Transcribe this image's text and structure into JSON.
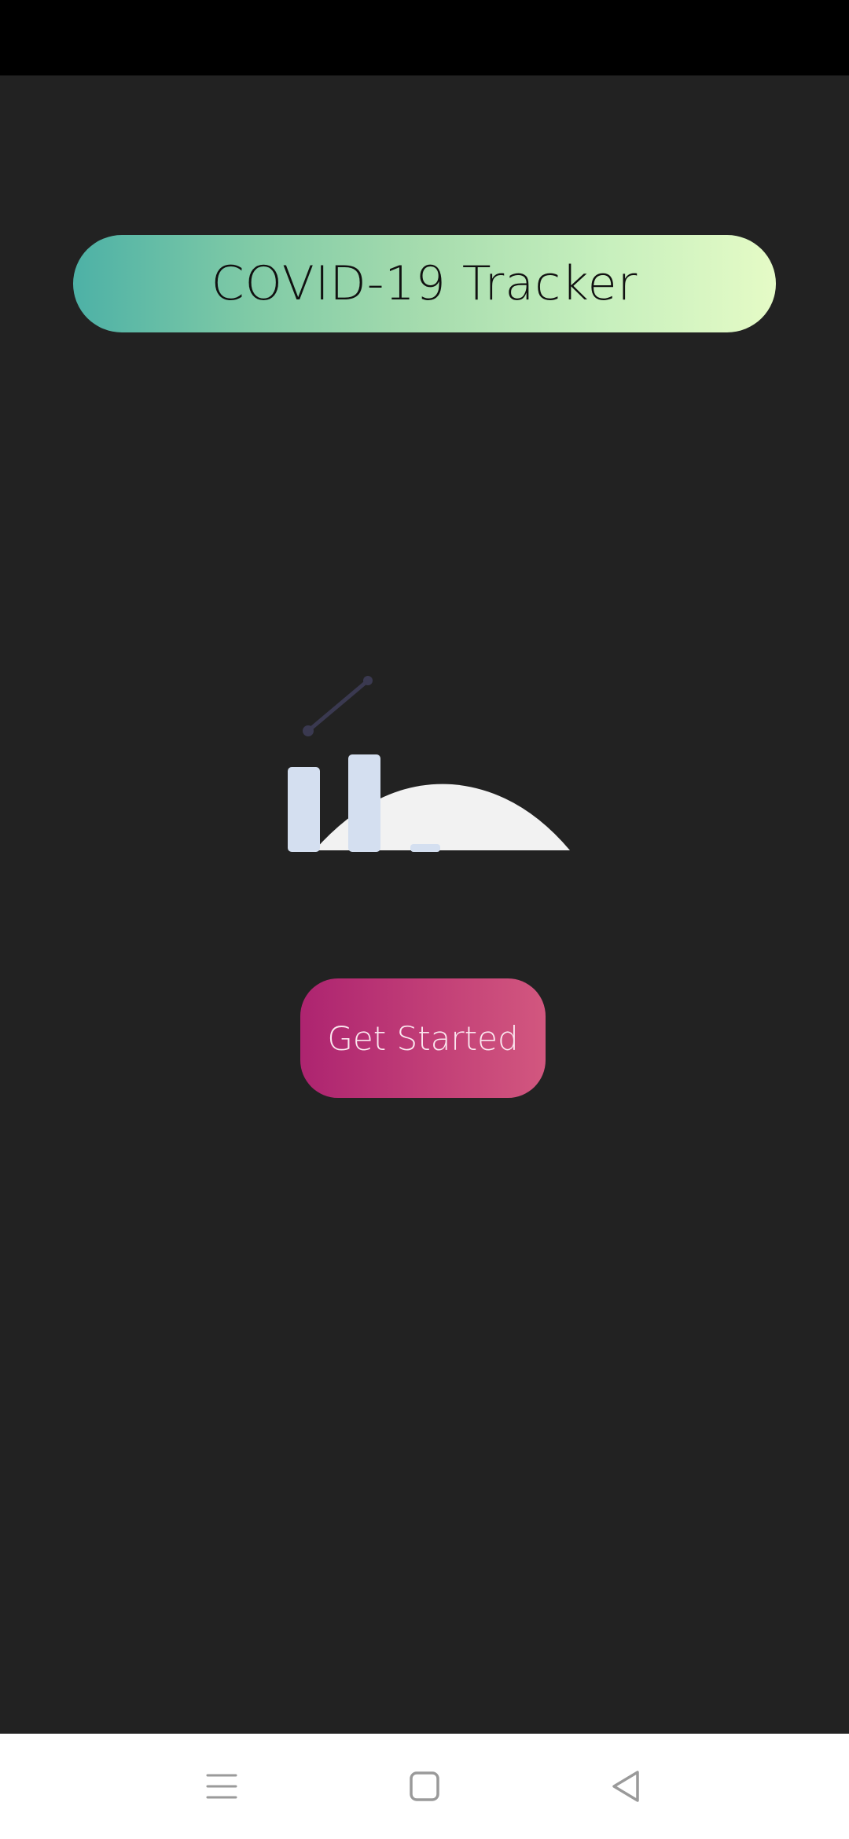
{
  "app": {
    "title": "COVID-19 Tracker"
  },
  "actions": {
    "get_started_label": "Get Started"
  },
  "illustration": {
    "name": "chart-illustration-icon"
  },
  "navigation": {
    "menu_icon": "menu-lines-icon",
    "home_icon": "square-home-icon",
    "back_icon": "triangle-back-icon"
  },
  "colors": {
    "background": "#222222",
    "status_bar": "#000000",
    "title_gradient_start": "#4db1a6",
    "title_gradient_end": "#e5fbc6",
    "button_gradient_start": "#ad2470",
    "button_gradient_end": "#d2577f",
    "nav_bar": "#ffffff"
  }
}
